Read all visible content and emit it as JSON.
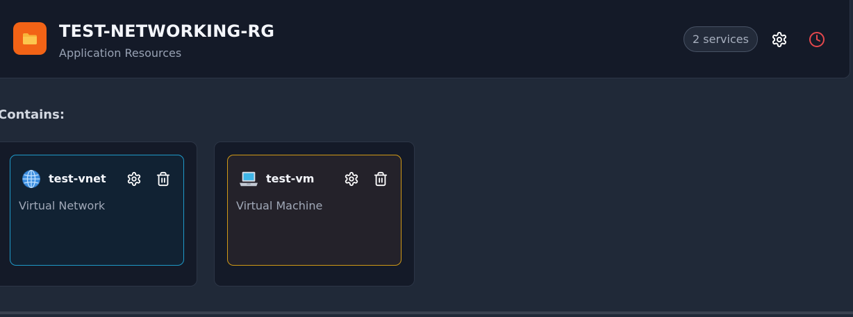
{
  "header": {
    "title": "TEST-NETWORKING-RG",
    "subtitle": "Application Resources",
    "services_badge": "2 services",
    "icon": "folder-icon",
    "accent": "#f26316",
    "settings_icon": "gear-icon",
    "history_icon": "clock-icon",
    "history_color": "#e5484d"
  },
  "section": {
    "contains_label": "Contains:"
  },
  "services": [
    {
      "name": "test-vnet",
      "type": "Virtual Network",
      "icon": "globe-icon",
      "border_color": "#1f9ac9"
    },
    {
      "name": "test-vm",
      "type": "Virtual Machine",
      "icon": "laptop-icon",
      "border_color": "#d19a16"
    }
  ]
}
